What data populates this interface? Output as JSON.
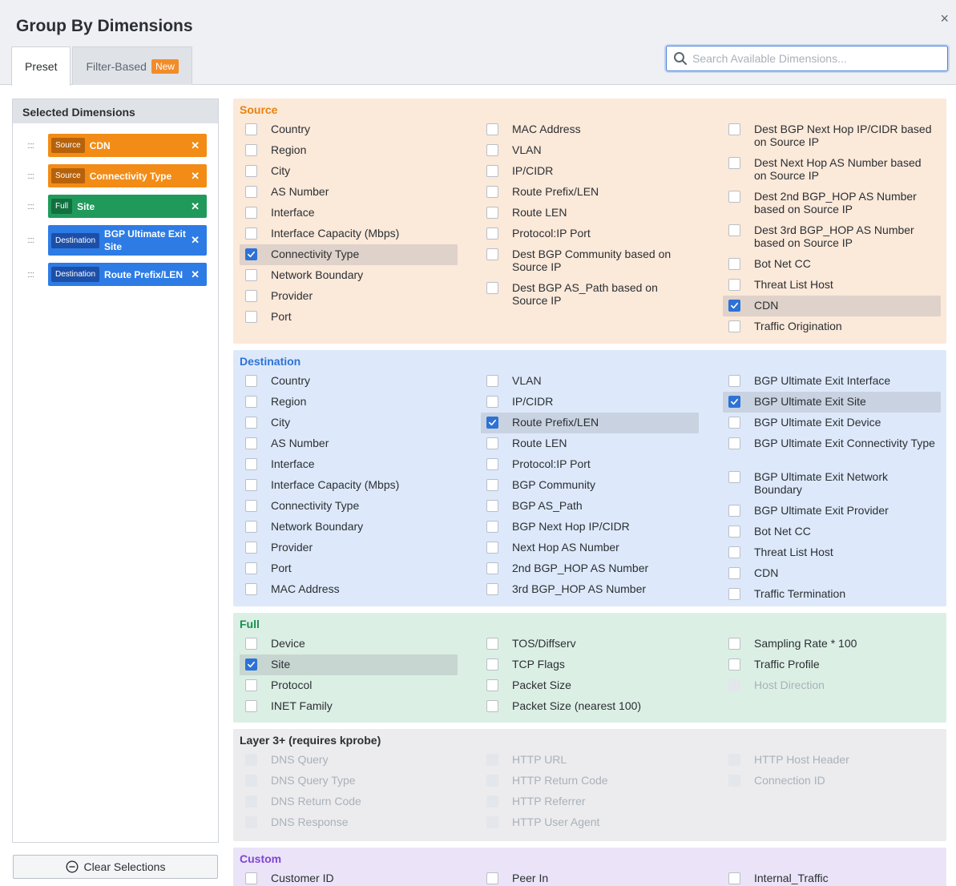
{
  "dialog": {
    "title": "Group By Dimensions",
    "close": "×"
  },
  "tabs": {
    "preset": "Preset",
    "filter_based": "Filter-Based",
    "new_badge": "New"
  },
  "search": {
    "placeholder": "Search Available Dimensions..."
  },
  "selected": {
    "title": "Selected Dimensions",
    "handle": "::::",
    "remove": "✕",
    "chips": [
      {
        "tag": "Source",
        "label": "CDN",
        "kind": "source"
      },
      {
        "tag": "Source",
        "label": "Connectivity Type",
        "kind": "source"
      },
      {
        "tag": "Full",
        "label": "Site",
        "kind": "full"
      },
      {
        "tag": "Destination",
        "label": "BGP Ultimate Exit Site",
        "kind": "destination"
      },
      {
        "tag": "Destination",
        "label": "Route Prefix/LEN",
        "kind": "destination"
      }
    ],
    "clear_label": "Clear Selections"
  },
  "panels": {
    "source": {
      "title": "Source",
      "col0": [
        {
          "label": "Country"
        },
        {
          "label": "Region"
        },
        {
          "label": "City"
        },
        {
          "label": "AS Number"
        },
        {
          "label": "Interface"
        },
        {
          "label": "Interface Capacity (Mbps)"
        },
        {
          "label": "Connectivity Type",
          "checked": true
        },
        {
          "label": "Network Boundary"
        },
        {
          "label": "Provider"
        },
        {
          "label": "Port"
        }
      ],
      "col1": [
        {
          "label": "MAC Address"
        },
        {
          "label": "VLAN"
        },
        {
          "label": "IP/CIDR"
        },
        {
          "label": "Route Prefix/LEN"
        },
        {
          "label": "Route LEN"
        },
        {
          "label": "Protocol:IP Port"
        },
        {
          "label": "Dest BGP Community based on Source IP"
        },
        {
          "label": "Dest BGP AS_Path based on Source IP"
        }
      ],
      "col2": [
        {
          "label": "Dest BGP Next Hop IP/CIDR based on Source IP"
        },
        {
          "label": "Dest Next Hop AS Number based on Source IP"
        },
        {
          "label": "Dest 2nd BGP_HOP AS Number based on Source IP"
        },
        {
          "label": "Dest 3rd BGP_HOP AS Number based on Source IP"
        },
        {
          "label": "Bot Net CC"
        },
        {
          "label": "Threat List Host"
        },
        {
          "label": "CDN",
          "checked": true
        },
        {
          "label": "Traffic Origination"
        }
      ]
    },
    "destination": {
      "title": "Destination",
      "col0": [
        {
          "label": "Country"
        },
        {
          "label": "Region"
        },
        {
          "label": "City"
        },
        {
          "label": "AS Number"
        },
        {
          "label": "Interface"
        },
        {
          "label": "Interface Capacity (Mbps)"
        },
        {
          "label": "Connectivity Type"
        },
        {
          "label": "Network Boundary"
        },
        {
          "label": "Provider"
        },
        {
          "label": "Port"
        },
        {
          "label": "MAC Address"
        }
      ],
      "col1": [
        {
          "label": "VLAN"
        },
        {
          "label": "IP/CIDR"
        },
        {
          "label": "Route Prefix/LEN",
          "checked": true
        },
        {
          "label": "Route LEN"
        },
        {
          "label": "Protocol:IP Port"
        },
        {
          "label": "BGP Community"
        },
        {
          "label": "BGP AS_Path"
        },
        {
          "label": "BGP Next Hop IP/CIDR"
        },
        {
          "label": "Next Hop AS Number"
        },
        {
          "label": "2nd BGP_HOP AS Number"
        },
        {
          "label": "3rd BGP_HOP AS Number"
        }
      ],
      "col2": [
        {
          "label": "BGP Ultimate Exit Interface"
        },
        {
          "label": "BGP Ultimate Exit Site",
          "checked": true
        },
        {
          "label": "BGP Ultimate Exit Device"
        },
        {
          "label": "BGP Ultimate Exit Connectivity Type"
        },
        {
          "label": "BGP Ultimate Exit Network Boundary"
        },
        {
          "label": "BGP Ultimate Exit Provider"
        },
        {
          "label": "Bot Net CC"
        },
        {
          "label": "Threat List Host"
        },
        {
          "label": "CDN"
        },
        {
          "label": "Traffic Termination"
        }
      ]
    },
    "full": {
      "title": "Full",
      "col0": [
        {
          "label": "Device"
        },
        {
          "label": "Site",
          "checked": true
        },
        {
          "label": "Protocol"
        },
        {
          "label": "INET Family"
        }
      ],
      "col1": [
        {
          "label": "TOS/Diffserv"
        },
        {
          "label": "TCP Flags"
        },
        {
          "label": "Packet Size"
        },
        {
          "label": "Packet Size (nearest 100)"
        }
      ],
      "col2": [
        {
          "label": "Sampling Rate * 100"
        },
        {
          "label": "Traffic Profile"
        },
        {
          "label": "Host Direction",
          "disabled": true
        }
      ]
    },
    "layer3": {
      "title": "Layer 3+ (requires kprobe)",
      "col0": [
        {
          "label": "DNS Query",
          "disabled": true
        },
        {
          "label": "DNS Query Type",
          "disabled": true
        },
        {
          "label": "DNS Return Code",
          "disabled": true
        },
        {
          "label": "DNS Response",
          "disabled": true
        }
      ],
      "col1": [
        {
          "label": "HTTP URL",
          "disabled": true
        },
        {
          "label": "HTTP Return Code",
          "disabled": true
        },
        {
          "label": "HTTP Referrer",
          "disabled": true
        },
        {
          "label": "HTTP User Agent",
          "disabled": true
        }
      ],
      "col2": [
        {
          "label": "HTTP Host Header",
          "disabled": true
        },
        {
          "label": "Connection ID",
          "disabled": true
        }
      ]
    },
    "custom": {
      "title": "Custom",
      "col0": [
        {
          "label": "Customer ID"
        }
      ],
      "col1": [
        {
          "label": "Peer In"
        }
      ],
      "col2": [
        {
          "label": "Internal_Traffic"
        }
      ]
    }
  }
}
